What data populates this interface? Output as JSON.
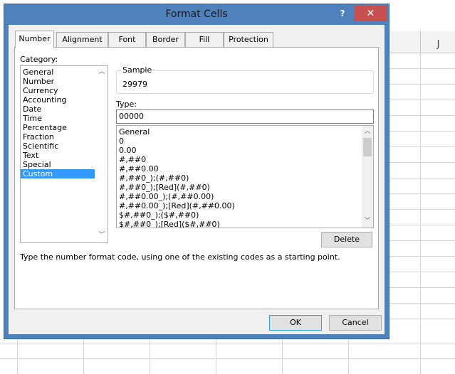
{
  "sheet": {
    "column_letter": "J"
  },
  "dialog": {
    "title": "Format Cells",
    "help_label": "?",
    "close_label": "✕",
    "tabs": [
      {
        "label": "Number",
        "active": true
      },
      {
        "label": "Alignment",
        "active": false
      },
      {
        "label": "Font",
        "active": false
      },
      {
        "label": "Border",
        "active": false
      },
      {
        "label": "Fill",
        "active": false
      },
      {
        "label": "Protection",
        "active": false
      }
    ],
    "category": {
      "label": "Category:",
      "items": [
        "General",
        "Number",
        "Currency",
        "Accounting",
        "Date",
        "Time",
        "Percentage",
        "Fraction",
        "Scientific",
        "Text",
        "Special",
        "Custom"
      ],
      "selected": "Custom"
    },
    "sample": {
      "label": "Sample",
      "value": "29979"
    },
    "type": {
      "label": "Type:",
      "value": "00000",
      "items": [
        "General",
        "0",
        "0.00",
        "#,##0",
        "#,##0.00",
        "#,##0_);(#,##0)",
        "#,##0_);[Red](#,##0)",
        "#,##0.00_);(#,##0.00)",
        "#,##0.00_);[Red](#,##0.00)",
        "$#,##0_);($#,##0)",
        "$#,##0_);[Red]($#,##0)"
      ]
    },
    "delete_label": "Delete",
    "hint": "Type the number format code, using one of the existing codes as a starting point.",
    "ok_label": "OK",
    "cancel_label": "Cancel"
  }
}
